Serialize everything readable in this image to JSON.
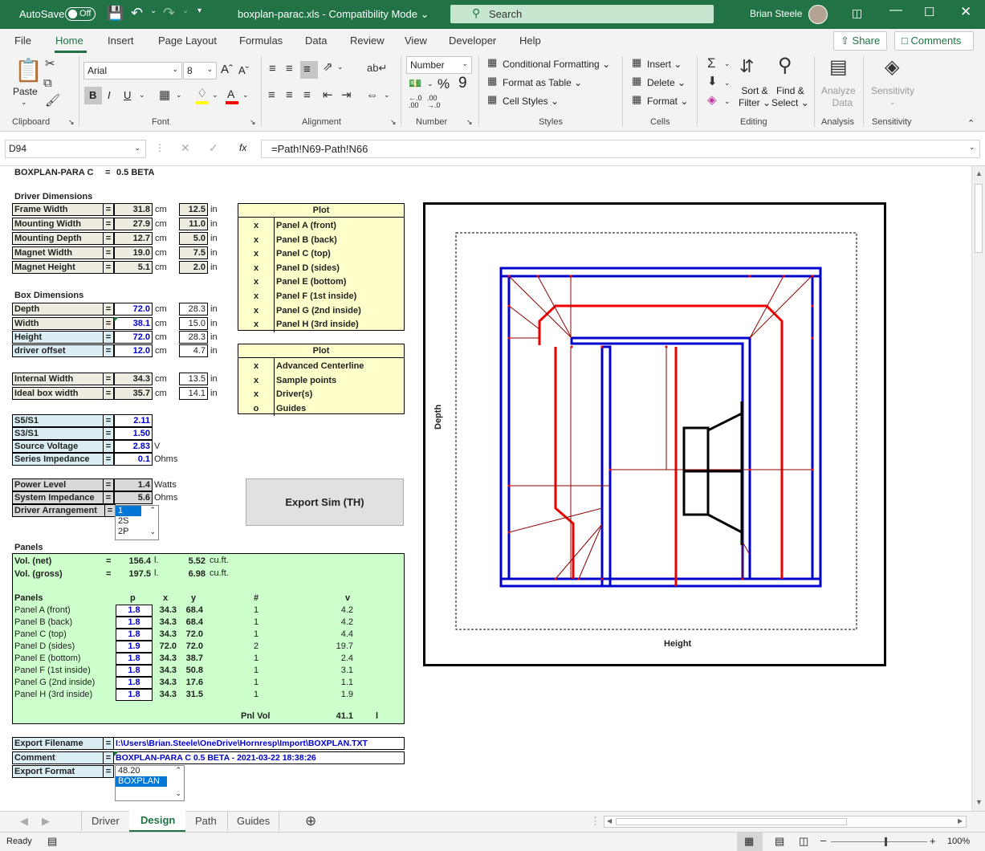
{
  "titlebar": {
    "autosave_label": "AutoSave",
    "autosave_state": "Off",
    "filename": "boxplan-parac.xls",
    "mode": "Compatibility Mode",
    "search_placeholder": "Search",
    "user": "Brian Steele"
  },
  "ribbon_tabs": [
    "File",
    "Home",
    "Insert",
    "Page Layout",
    "Formulas",
    "Data",
    "Review",
    "View",
    "Developer",
    "Help"
  ],
  "active_tab": "Home",
  "share_label": "Share",
  "comments_label": "Comments",
  "ribbon": {
    "clipboard": {
      "paste": "Paste",
      "group": "Clipboard"
    },
    "font": {
      "family": "Arial",
      "size": "8",
      "bold": "B",
      "italic": "I",
      "underline": "U",
      "group": "Font"
    },
    "alignment": {
      "group": "Alignment"
    },
    "number": {
      "format": "Number",
      "percent": "%",
      "comma": "9",
      "group": "Number"
    },
    "styles": {
      "conditional": "Conditional Formatting",
      "table": "Format as Table",
      "cell_styles": "Cell Styles",
      "group": "Styles"
    },
    "cells": {
      "insert": "Insert",
      "delete": "Delete",
      "format": "Format",
      "group": "Cells"
    },
    "editing": {
      "sort1": "Sort &",
      "sort2": "Filter",
      "find1": "Find &",
      "find2": "Select",
      "group": "Editing"
    },
    "analysis": {
      "l1": "Analyze",
      "l2": "Data",
      "group": "Analysis"
    },
    "sensitivity": {
      "l1": "Sensitivity",
      "group": "Sensitivity"
    }
  },
  "formula_bar": {
    "name_box": "D94",
    "fx": "fx",
    "formula": "=Path!N69-Path!N66"
  },
  "sheet": {
    "title": "BOXPLAN-PARA C",
    "title_eq": "=",
    "version": "0.5 BETA",
    "driver_dims": {
      "heading": "Driver Dimensions",
      "rows": [
        {
          "label": "Frame Width",
          "eq": "=",
          "cm": "31.8",
          "cm_unit": "cm",
          "in": "12.5",
          "in_unit": "in"
        },
        {
          "label": "Mounting Width",
          "eq": "=",
          "cm": "27.9",
          "cm_unit": "cm",
          "in": "11.0",
          "in_unit": "in"
        },
        {
          "label": "Mounting Depth",
          "eq": "=",
          "cm": "12.7",
          "cm_unit": "cm",
          "in": "5.0",
          "in_unit": "in"
        },
        {
          "label": "Magnet Width",
          "eq": "=",
          "cm": "19.0",
          "cm_unit": "cm",
          "in": "7.5",
          "in_unit": "in"
        },
        {
          "label": "Magnet Height",
          "eq": "=",
          "cm": "5.1",
          "cm_unit": "cm",
          "in": "2.0",
          "in_unit": "in"
        }
      ]
    },
    "box_dims": {
      "heading": "Box Dimensions",
      "rows": [
        {
          "label": "Depth",
          "eq": "=",
          "cm": "72.0",
          "cm_unit": "cm",
          "in": "28.3",
          "in_unit": "in"
        },
        {
          "label": "Width",
          "eq": "=",
          "cm": "38.1",
          "cm_unit": "cm",
          "in": "15.0",
          "in_unit": "in"
        },
        {
          "label": "Height",
          "eq": "=",
          "cm": "72.0",
          "cm_unit": "cm",
          "in": "28.3",
          "in_unit": "in"
        },
        {
          "label": "driver offset",
          "eq": "=",
          "cm": "12.0",
          "cm_unit": "cm",
          "in": "4.7",
          "in_unit": "in"
        }
      ]
    },
    "internal": {
      "rows": [
        {
          "label": "Internal Width",
          "eq": "=",
          "cm": "34.3",
          "cm_unit": "cm",
          "in": "13.5",
          "in_unit": "in"
        },
        {
          "label": "Ideal box width",
          "eq": "=",
          "cm": "35.7",
          "cm_unit": "cm",
          "in": "14.1",
          "in_unit": "in"
        }
      ]
    },
    "ratios": {
      "rows": [
        {
          "label": "S5/S1",
          "eq": "=",
          "val": "2.11",
          "unit": ""
        },
        {
          "label": "S3/S1",
          "eq": "=",
          "val": "1.50",
          "unit": ""
        },
        {
          "label": "Source Voltage",
          "eq": "=",
          "val": "2.83",
          "unit": "V"
        },
        {
          "label": "Series Impedance",
          "eq": "=",
          "val": "0.1",
          "unit": "Ohms"
        }
      ]
    },
    "power": {
      "rows": [
        {
          "label": "Power Level",
          "eq": "=",
          "val": "1.4",
          "unit": "Watts"
        },
        {
          "label": "System Impedance",
          "eq": "=",
          "val": "5.6",
          "unit": "Ohms"
        },
        {
          "label": "Driver Arrangement",
          "eq": "=",
          "val": "",
          "unit": ""
        }
      ],
      "arrangement_options": [
        "1",
        "2S",
        "2P"
      ]
    },
    "plot1": {
      "heading": "Plot",
      "rows": [
        {
          "mark": "x",
          "label": "Panel A (front)"
        },
        {
          "mark": "x",
          "label": "Panel B (back)"
        },
        {
          "mark": "x",
          "label": "Panel C (top)"
        },
        {
          "mark": "x",
          "label": "Panel D (sides)"
        },
        {
          "mark": "x",
          "label": "Panel E (bottom)"
        },
        {
          "mark": "x",
          "label": "Panel F (1st inside)"
        },
        {
          "mark": "x",
          "label": "Panel G (2nd inside)"
        },
        {
          "mark": "x",
          "label": "Panel H (3rd inside)"
        }
      ]
    },
    "plot2": {
      "heading": "Plot",
      "rows": [
        {
          "mark": "x",
          "label": "Advanced Centerline"
        },
        {
          "mark": "x",
          "label": "Sample points"
        },
        {
          "mark": "x",
          "label": "Driver(s)"
        },
        {
          "mark": "o",
          "label": "Guides"
        }
      ]
    },
    "export_button": "Export Sim (TH)",
    "panels_heading": "Panels",
    "vol": [
      {
        "label": "Vol. (net)",
        "eq": "=",
        "l": "156.4",
        "l_unit": "l.",
        "cuft": "5.52",
        "cuft_unit": "cu.ft."
      },
      {
        "label": "Vol. (gross)",
        "eq": "=",
        "l": "197.5",
        "l_unit": "l.",
        "cuft": "6.98",
        "cuft_unit": "cu.ft."
      }
    ],
    "panels_table": {
      "headers": {
        "name": "Panels",
        "p": "p",
        "x": "x",
        "y": "y",
        "n": "#",
        "v": "v"
      },
      "rows": [
        {
          "name": "Panel A (front)",
          "p": "1.8",
          "x": "34.3",
          "y": "68.4",
          "n": "1",
          "v": "4.2"
        },
        {
          "name": "Panel B (back)",
          "p": "1.8",
          "x": "34.3",
          "y": "68.4",
          "n": "1",
          "v": "4.2"
        },
        {
          "name": "Panel C (top)",
          "p": "1.8",
          "x": "34.3",
          "y": "72.0",
          "n": "1",
          "v": "4.4"
        },
        {
          "name": "Panel D (sides)",
          "p": "1.9",
          "x": "72.0",
          "y": "72.0",
          "n": "2",
          "v": "19.7"
        },
        {
          "name": "Panel E (bottom)",
          "p": "1.8",
          "x": "34.3",
          "y": "38.7",
          "n": "1",
          "v": "2.4"
        },
        {
          "name": "Panel F (1st inside)",
          "p": "1.8",
          "x": "34.3",
          "y": "50.8",
          "n": "1",
          "v": "3.1"
        },
        {
          "name": "Panel G (2nd inside)",
          "p": "1.8",
          "x": "34.3",
          "y": "17.6",
          "n": "1",
          "v": "1.1"
        },
        {
          "name": "Panel H (3rd inside)",
          "p": "1.8",
          "x": "34.3",
          "y": "31.5",
          "n": "1",
          "v": "1.9"
        }
      ],
      "pnl_vol_label": "Pnl Vol",
      "pnl_vol": "41.1",
      "pnl_vol_unit": "l"
    },
    "export": {
      "filename_label": "Export Filename",
      "filename": "I:\\Users\\Brian.Steele\\OneDrive\\Hornresp\\Import\\BOXPLAN.TXT",
      "comment_label": "Comment",
      "comment": "BOXPLAN-PARA C 0.5 BETA - 2021-03-22 18:38:26",
      "format_label": "Export Format",
      "eq": "=",
      "format_options": [
        "48.20",
        "BOXPLAN"
      ]
    },
    "diagram": {
      "xlabel": "Height",
      "ylabel": "Depth"
    }
  },
  "sheet_tabs": [
    "Driver",
    "Design",
    "Path",
    "Guides"
  ],
  "active_sheet": "Design",
  "status": {
    "ready": "Ready",
    "zoom": "100%"
  }
}
